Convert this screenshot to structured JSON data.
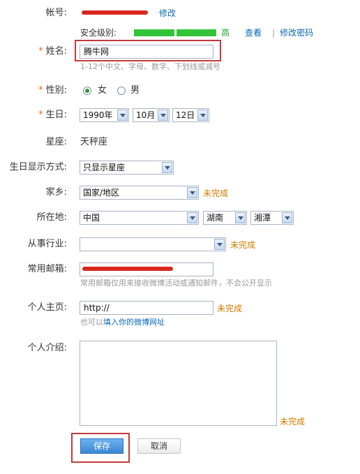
{
  "account": {
    "label": "帐号:",
    "value": "",
    "edit_link": "修改"
  },
  "security": {
    "label": "安全级别:",
    "level": "高",
    "level_fraction": 1.0,
    "bar_color": "#33c43a",
    "view_link": "查看",
    "separator": "|",
    "change_pwd_link": "修改密码"
  },
  "name": {
    "required_mark": "*",
    "label": "姓名:",
    "value": "腾牛网",
    "hint": "1-12个中文、字母、数字、下划线或减号"
  },
  "gender": {
    "required_mark": "*",
    "label": "性别:",
    "options": [
      "女",
      "男"
    ],
    "selected": "女"
  },
  "birthday": {
    "required_mark": "*",
    "label": "生日:",
    "year": "1990年",
    "month": "10月",
    "day": "12日"
  },
  "zodiac": {
    "label": "星座:",
    "value": "天秤座"
  },
  "birthday_display": {
    "label": "生日显示方式:",
    "value": "只显示星座"
  },
  "hometown": {
    "label": "家乡:",
    "value": "国家/地区",
    "status": "未完成"
  },
  "location": {
    "label": "所在地:",
    "country": "中国",
    "province": "湖南",
    "city": "湘潭"
  },
  "industry": {
    "label": "从事行业:",
    "value": "",
    "status": "未完成"
  },
  "email": {
    "label": "常用邮箱:",
    "value": "",
    "hint": "常用邮箱仅用来接收微博活动或通知邮件，不会公开显示"
  },
  "homepage": {
    "label": "个人主页:",
    "value": "http://",
    "status": "未完成",
    "hint_prefix": "也可以",
    "hint_link": "填入你的微博网址"
  },
  "intro": {
    "label": "个人介绍:",
    "value": "",
    "status": "未完成"
  },
  "actions": {
    "save_label": "保存",
    "cancel_label": "取消"
  },
  "colors": {
    "highlight_box": "#c23a3a",
    "link": "#0a67b3",
    "required": "#e06a1a",
    "incomplete": "#d07a00",
    "security_bar": "#33c43a",
    "save_button": "#3b86d3"
  }
}
